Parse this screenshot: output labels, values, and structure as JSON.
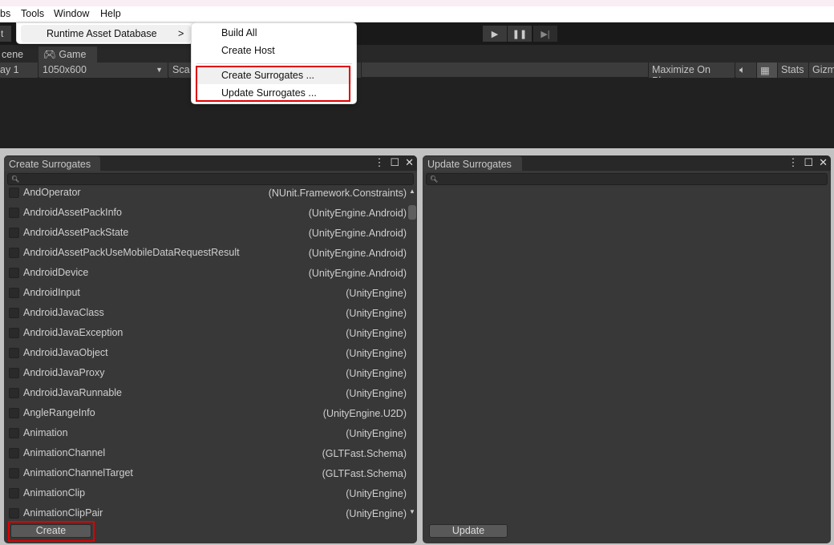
{
  "menubar": {
    "items": [
      "bs",
      "Tools",
      "Window",
      "Help"
    ]
  },
  "playbar": {
    "play": "▶",
    "pause": "❚❚",
    "step": "▶|"
  },
  "toolbar": {
    "left_fragment": "t"
  },
  "tabs": {
    "scene": "cene",
    "game": "Game",
    "game_icon": "gamepad-icon"
  },
  "game_toolbar": {
    "display": "ay 1",
    "resolution": "1050x600",
    "scale": "Sca",
    "maximize": "Maximize On Play",
    "stats": "Stats",
    "gizmos": "Gizm"
  },
  "tools_menu": {
    "item": "Runtime Asset Database",
    "arrow": ">"
  },
  "submenu": {
    "items": [
      "Build All",
      "Create Host",
      "Create Surrogates ...",
      "Update Surrogates ..."
    ]
  },
  "create_panel": {
    "title": "Create Surrogates",
    "button": "Create",
    "rows": [
      {
        "name": "AndOperator",
        "ns": "(NUnit.Framework.Constraints)"
      },
      {
        "name": "AndroidAssetPackInfo",
        "ns": "(UnityEngine.Android)"
      },
      {
        "name": "AndroidAssetPackState",
        "ns": "(UnityEngine.Android)"
      },
      {
        "name": "AndroidAssetPackUseMobileDataRequestResult",
        "ns": "(UnityEngine.Android)"
      },
      {
        "name": "AndroidDevice",
        "ns": "(UnityEngine.Android)"
      },
      {
        "name": "AndroidInput",
        "ns": "(UnityEngine)"
      },
      {
        "name": "AndroidJavaClass",
        "ns": "(UnityEngine)"
      },
      {
        "name": "AndroidJavaException",
        "ns": "(UnityEngine)"
      },
      {
        "name": "AndroidJavaObject",
        "ns": "(UnityEngine)"
      },
      {
        "name": "AndroidJavaProxy",
        "ns": "(UnityEngine)"
      },
      {
        "name": "AndroidJavaRunnable",
        "ns": "(UnityEngine)"
      },
      {
        "name": "AngleRangeInfo",
        "ns": "(UnityEngine.U2D)"
      },
      {
        "name": "Animation",
        "ns": "(UnityEngine)"
      },
      {
        "name": "AnimationChannel",
        "ns": "(GLTFast.Schema)"
      },
      {
        "name": "AnimationChannelTarget",
        "ns": "(GLTFast.Schema)"
      },
      {
        "name": "AnimationClip",
        "ns": "(UnityEngine)"
      },
      {
        "name": "AnimationClipPair",
        "ns": "(UnityEngine)"
      }
    ]
  },
  "update_panel": {
    "title": "Update Surrogates",
    "button": "Update"
  },
  "colors": {
    "highlight": "#e00000",
    "panel": "#383838"
  }
}
